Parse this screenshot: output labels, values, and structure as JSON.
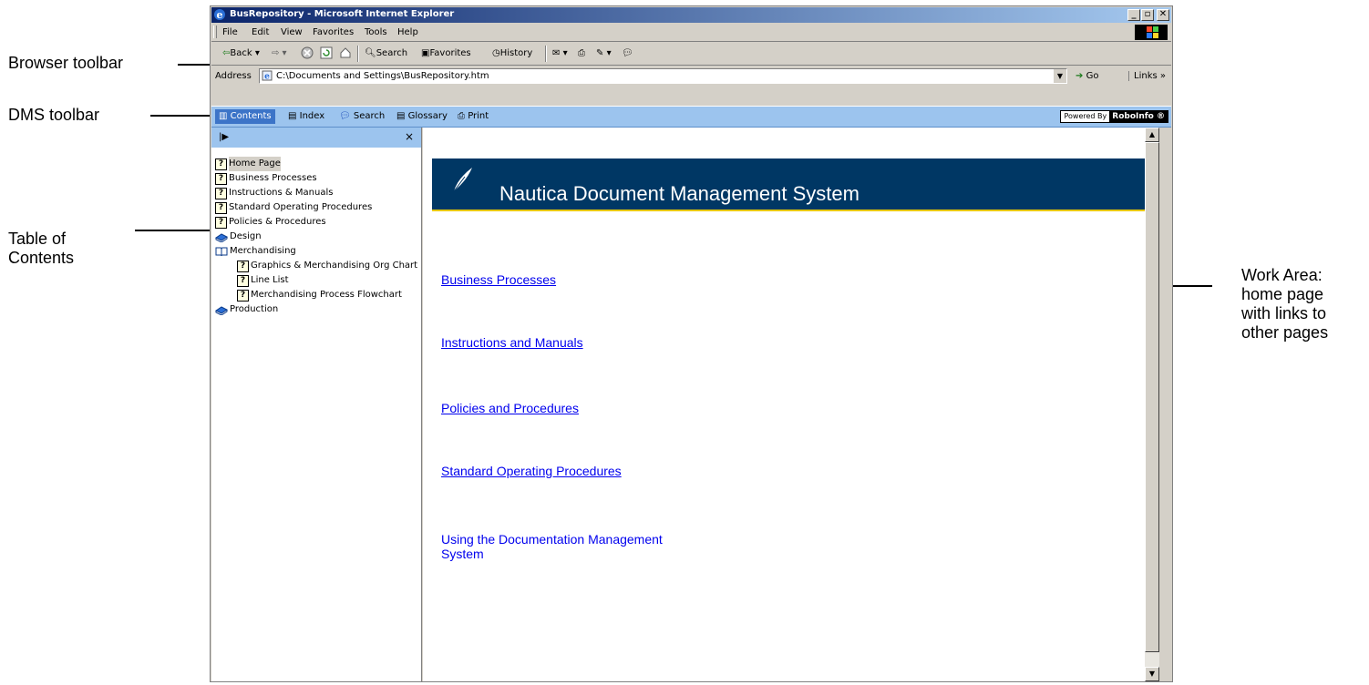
{
  "annotations": {
    "browser_toolbar": "Browser toolbar",
    "dms_toolbar": "DMS toolbar",
    "table_of_contents": "Table of\nContents",
    "work_area": "Work Area:\nhome page\nwith links to\nother pages"
  },
  "window": {
    "title": "BusRepository - Microsoft Internet Explorer",
    "controls": {
      "minimize": "_",
      "maximize": "▫",
      "close": "✕"
    }
  },
  "menu": [
    "File",
    "Edit",
    "View",
    "Favorites",
    "Tools",
    "Help"
  ],
  "toolbar": {
    "back": "Back",
    "search": "Search",
    "favorites": "Favorites",
    "history": "History"
  },
  "address": {
    "label": "Address",
    "value": "C:\\Documents and Settings\\BusRepository.htm",
    "go": "Go",
    "links": "Links »"
  },
  "dms": {
    "contents": "Contents",
    "index": "Index",
    "search": "Search",
    "glossary": "Glossary",
    "print": "Print",
    "powered_by": "Powered By",
    "brand": "RoboInfo ®"
  },
  "toc": {
    "close": "×",
    "items": [
      {
        "label": "Home Page",
        "icon": "help-topic-icon"
      },
      {
        "label": "Business Processes",
        "icon": "help-topic-icon"
      },
      {
        "label": "Instructions & Manuals",
        "icon": "help-topic-icon"
      },
      {
        "label": "Standard Operating Procedures",
        "icon": "help-topic-icon"
      },
      {
        "label": "Policies & Procedures",
        "icon": "help-topic-icon"
      },
      {
        "label": "Design",
        "icon": "closed-book-icon"
      },
      {
        "label": "Merchandising",
        "icon": "open-book-icon"
      },
      {
        "label": "Graphics & Merchandising Org Chart",
        "icon": "help-topic-icon"
      },
      {
        "label": "Line List",
        "icon": "help-topic-icon"
      },
      {
        "label": "Merchandising Process Flowchart",
        "icon": "help-topic-icon"
      },
      {
        "label": "Production",
        "icon": "closed-book-icon"
      }
    ]
  },
  "content": {
    "banner_title": "Nautica Document Management System",
    "links": [
      "Business Processes",
      "Instructions and Manuals",
      "Policies and Procedures",
      "Standard Operating Procedures",
      "Using the Documentation Management\nSystem"
    ]
  },
  "colors": {
    "titlebar_start": "#0a246a",
    "dms_bar": "#9cc4ee",
    "banner": "#003764",
    "banner_rule": "#e8c800",
    "link": "#0000ee"
  }
}
